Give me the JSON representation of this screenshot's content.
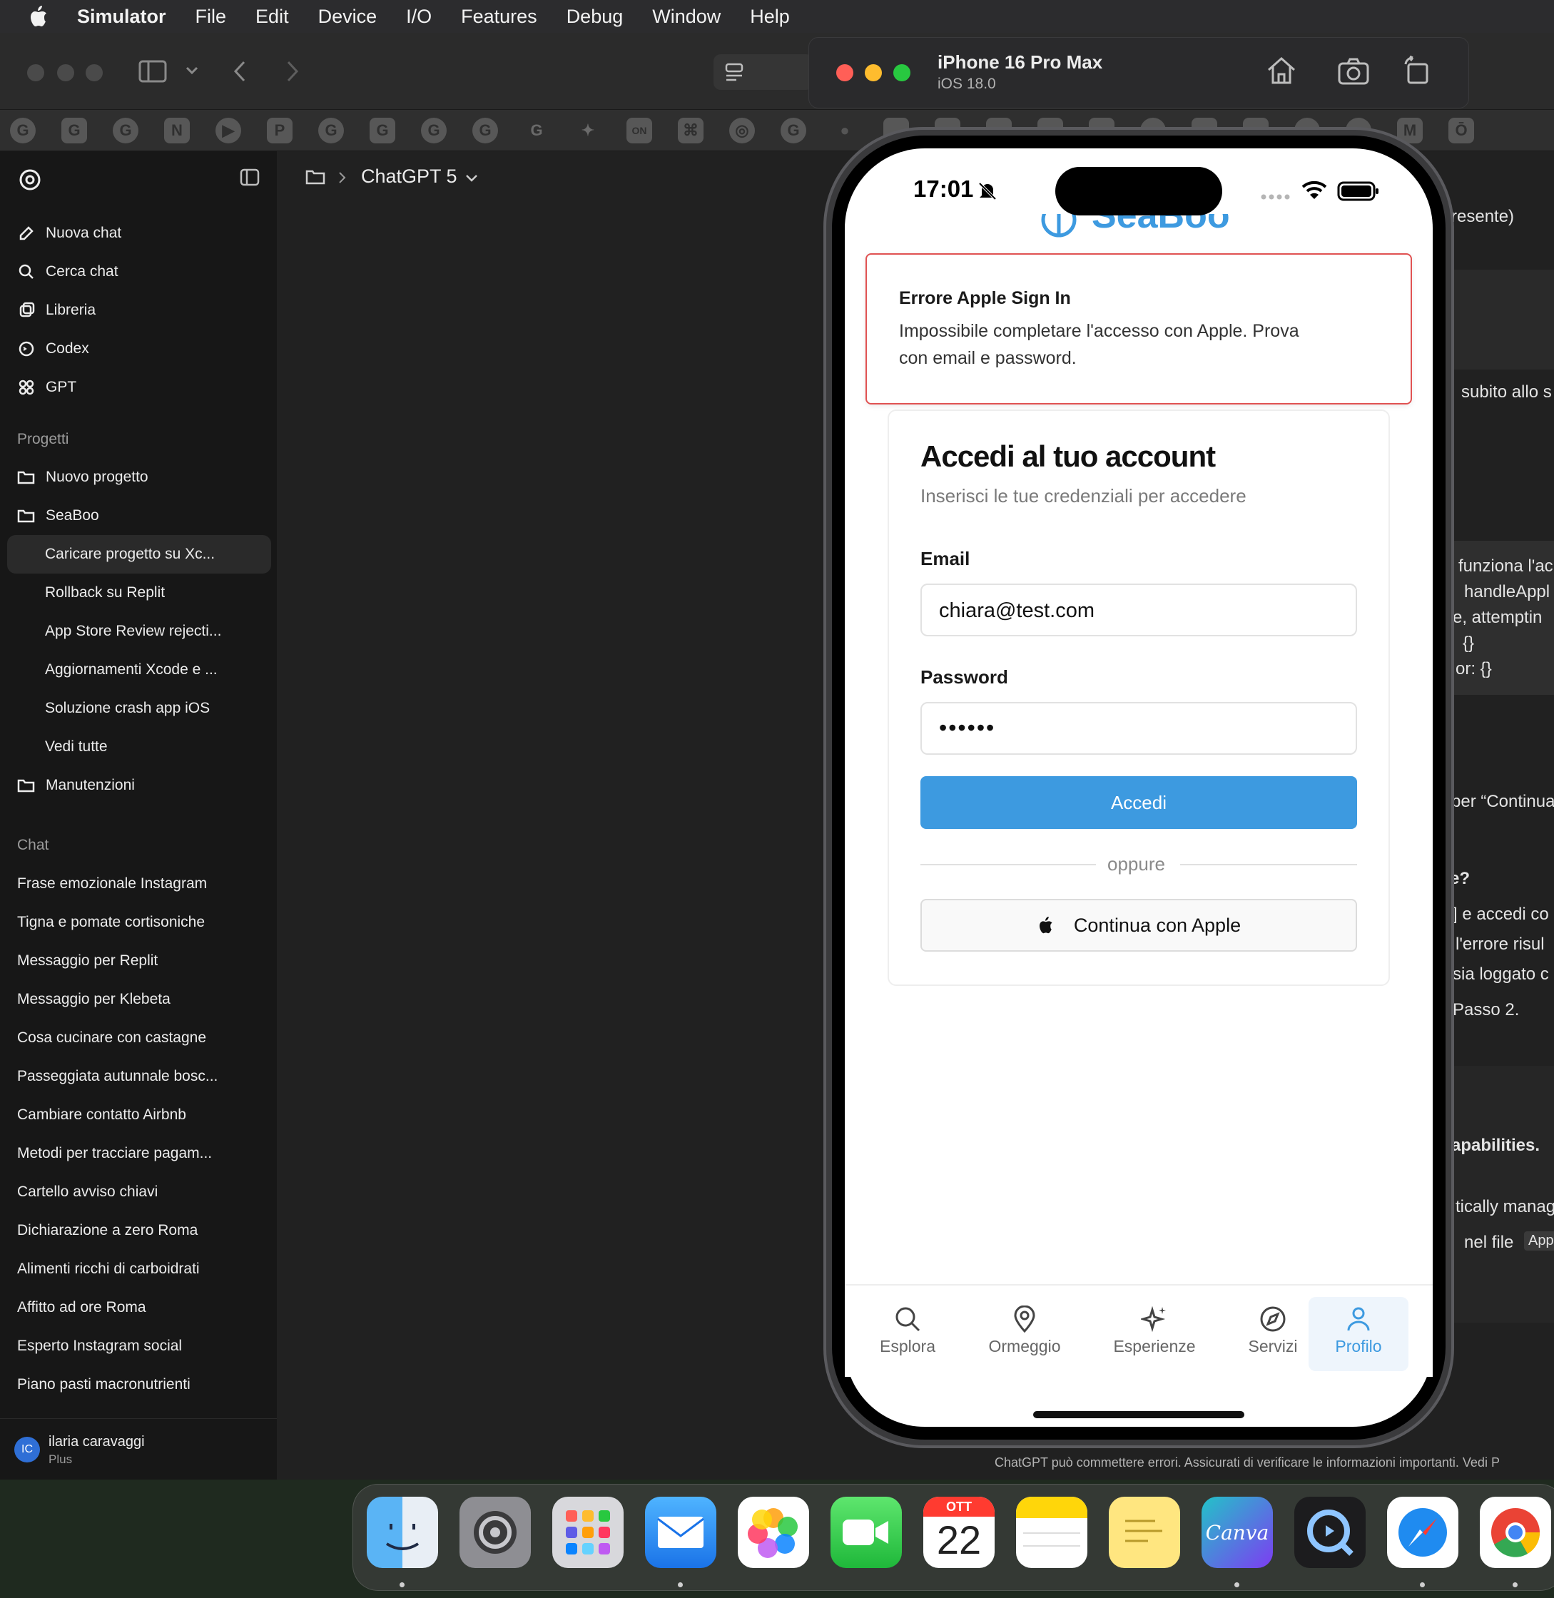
{
  "menubar": {
    "app": "Simulator",
    "items": [
      "File",
      "Edit",
      "Device",
      "I/O",
      "Features",
      "Debug",
      "Window",
      "Help"
    ]
  },
  "simulator": {
    "device": "iPhone 16 Pro Max",
    "os": "iOS 18.0"
  },
  "chatgpt": {
    "model": "ChatGPT 5",
    "nav": [
      "Nuova chat",
      "Cerca chat",
      "Libreria",
      "Codex",
      "GPT"
    ],
    "projects_heading": "Progetti",
    "new_project": "Nuovo progetto",
    "project_seaboo": "SeaBoo",
    "project_chats": [
      "Caricare progetto su Xc...",
      "Rollback su Replit",
      "App Store Review rejecti...",
      "Aggiornamenti Xcode e ...",
      "Soluzione crash app iOS",
      "Vedi tutte"
    ],
    "project_maint": "Manutenzioni",
    "chats_heading": "Chat",
    "chats": [
      "Frase emozionale Instagram",
      "Tigna e pomate cortisoniche",
      "Messaggio per Replit",
      "Messaggio per Klebeta",
      "Cosa cucinare con castagne",
      "Passeggiata autunnale bosc...",
      "Cambiare contatto Airbnb",
      "Metodi per tracciare pagam...",
      "Cartello avviso chiavi",
      "Dichiarazione a zero Roma",
      "Alimenti ricchi di carboidrati",
      "Affitto ad ore Roma",
      "Esperto Instagram social",
      "Piano pasti macronutrienti"
    ],
    "user_initials": "IC",
    "user_name": "ilaria caravaggi",
    "user_plan": "Plus",
    "footer": "ChatGPT può commettere errori. Assicurati di verificare le informazioni importanti. Vedi P",
    "bg_snippets": [
      "resente)",
      "subito allo s",
      "funziona l'ac",
      "handleAppl",
      "e, attemptin",
      "{}",
      "or: {}",
      "per “Continua",
      "e?",
      "] e accedi co",
      "l'errore risul",
      "sia loggato c",
      "Passo 2.",
      "apabilities.",
      "tically manag",
      "nel file",
      "App"
    ]
  },
  "phone": {
    "time": "17:01",
    "brand_partial": "SeaBoo",
    "error_title": "Errore Apple Sign In",
    "error_line1": "Impossibile completare l'accesso con Apple. Prova",
    "error_line2": "con email e password.",
    "login_title": "Accedi al tuo account",
    "login_subtitle": "Inserisci le tue credenziali per accedere",
    "email_label": "Email",
    "email_value": "chiara@test.com",
    "password_label": "Password",
    "password_value": "••••••",
    "login_button": "Accedi",
    "or": "oppure",
    "apple_button": "Continua con Apple",
    "tabs": [
      "Esplora",
      "Ormeggio",
      "Esperienze",
      "Servizi",
      "Profilo"
    ],
    "active_tab_color": "#3d9ae0"
  },
  "dock": {
    "calendar_month": "OTT",
    "calendar_day": "22",
    "canva": "Canva",
    "apps": [
      "finder-icon",
      "settings-icon",
      "launchpad-icon",
      "mail-icon",
      "photos-icon",
      "facetime-icon",
      "calendar-icon",
      "notes-icon",
      "stickies-icon",
      "canva-icon",
      "quicktime-icon",
      "safari-icon",
      "chrome-icon"
    ]
  }
}
